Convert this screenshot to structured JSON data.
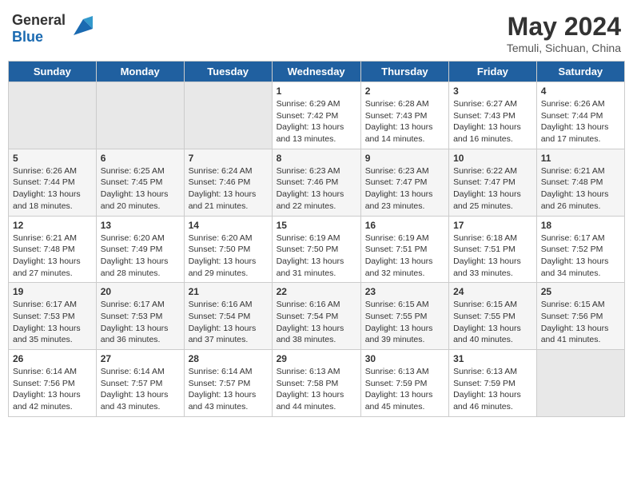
{
  "header": {
    "logo_general": "General",
    "logo_blue": "Blue",
    "title": "May 2024",
    "subtitle": "Temuli, Sichuan, China"
  },
  "days_of_week": [
    "Sunday",
    "Monday",
    "Tuesday",
    "Wednesday",
    "Thursday",
    "Friday",
    "Saturday"
  ],
  "weeks": [
    {
      "days": [
        {
          "num": "",
          "info": ""
        },
        {
          "num": "",
          "info": ""
        },
        {
          "num": "",
          "info": ""
        },
        {
          "num": "1",
          "info": "Sunrise: 6:29 AM\nSunset: 7:42 PM\nDaylight: 13 hours\nand 13 minutes."
        },
        {
          "num": "2",
          "info": "Sunrise: 6:28 AM\nSunset: 7:43 PM\nDaylight: 13 hours\nand 14 minutes."
        },
        {
          "num": "3",
          "info": "Sunrise: 6:27 AM\nSunset: 7:43 PM\nDaylight: 13 hours\nand 16 minutes."
        },
        {
          "num": "4",
          "info": "Sunrise: 6:26 AM\nSunset: 7:44 PM\nDaylight: 13 hours\nand 17 minutes."
        }
      ]
    },
    {
      "days": [
        {
          "num": "5",
          "info": "Sunrise: 6:26 AM\nSunset: 7:44 PM\nDaylight: 13 hours\nand 18 minutes."
        },
        {
          "num": "6",
          "info": "Sunrise: 6:25 AM\nSunset: 7:45 PM\nDaylight: 13 hours\nand 20 minutes."
        },
        {
          "num": "7",
          "info": "Sunrise: 6:24 AM\nSunset: 7:46 PM\nDaylight: 13 hours\nand 21 minutes."
        },
        {
          "num": "8",
          "info": "Sunrise: 6:23 AM\nSunset: 7:46 PM\nDaylight: 13 hours\nand 22 minutes."
        },
        {
          "num": "9",
          "info": "Sunrise: 6:23 AM\nSunset: 7:47 PM\nDaylight: 13 hours\nand 23 minutes."
        },
        {
          "num": "10",
          "info": "Sunrise: 6:22 AM\nSunset: 7:47 PM\nDaylight: 13 hours\nand 25 minutes."
        },
        {
          "num": "11",
          "info": "Sunrise: 6:21 AM\nSunset: 7:48 PM\nDaylight: 13 hours\nand 26 minutes."
        }
      ]
    },
    {
      "days": [
        {
          "num": "12",
          "info": "Sunrise: 6:21 AM\nSunset: 7:48 PM\nDaylight: 13 hours\nand 27 minutes."
        },
        {
          "num": "13",
          "info": "Sunrise: 6:20 AM\nSunset: 7:49 PM\nDaylight: 13 hours\nand 28 minutes."
        },
        {
          "num": "14",
          "info": "Sunrise: 6:20 AM\nSunset: 7:50 PM\nDaylight: 13 hours\nand 29 minutes."
        },
        {
          "num": "15",
          "info": "Sunrise: 6:19 AM\nSunset: 7:50 PM\nDaylight: 13 hours\nand 31 minutes."
        },
        {
          "num": "16",
          "info": "Sunrise: 6:19 AM\nSunset: 7:51 PM\nDaylight: 13 hours\nand 32 minutes."
        },
        {
          "num": "17",
          "info": "Sunrise: 6:18 AM\nSunset: 7:51 PM\nDaylight: 13 hours\nand 33 minutes."
        },
        {
          "num": "18",
          "info": "Sunrise: 6:17 AM\nSunset: 7:52 PM\nDaylight: 13 hours\nand 34 minutes."
        }
      ]
    },
    {
      "days": [
        {
          "num": "19",
          "info": "Sunrise: 6:17 AM\nSunset: 7:53 PM\nDaylight: 13 hours\nand 35 minutes."
        },
        {
          "num": "20",
          "info": "Sunrise: 6:17 AM\nSunset: 7:53 PM\nDaylight: 13 hours\nand 36 minutes."
        },
        {
          "num": "21",
          "info": "Sunrise: 6:16 AM\nSunset: 7:54 PM\nDaylight: 13 hours\nand 37 minutes."
        },
        {
          "num": "22",
          "info": "Sunrise: 6:16 AM\nSunset: 7:54 PM\nDaylight: 13 hours\nand 38 minutes."
        },
        {
          "num": "23",
          "info": "Sunrise: 6:15 AM\nSunset: 7:55 PM\nDaylight: 13 hours\nand 39 minutes."
        },
        {
          "num": "24",
          "info": "Sunrise: 6:15 AM\nSunset: 7:55 PM\nDaylight: 13 hours\nand 40 minutes."
        },
        {
          "num": "25",
          "info": "Sunrise: 6:15 AM\nSunset: 7:56 PM\nDaylight: 13 hours\nand 41 minutes."
        }
      ]
    },
    {
      "days": [
        {
          "num": "26",
          "info": "Sunrise: 6:14 AM\nSunset: 7:56 PM\nDaylight: 13 hours\nand 42 minutes."
        },
        {
          "num": "27",
          "info": "Sunrise: 6:14 AM\nSunset: 7:57 PM\nDaylight: 13 hours\nand 43 minutes."
        },
        {
          "num": "28",
          "info": "Sunrise: 6:14 AM\nSunset: 7:57 PM\nDaylight: 13 hours\nand 43 minutes."
        },
        {
          "num": "29",
          "info": "Sunrise: 6:13 AM\nSunset: 7:58 PM\nDaylight: 13 hours\nand 44 minutes."
        },
        {
          "num": "30",
          "info": "Sunrise: 6:13 AM\nSunset: 7:59 PM\nDaylight: 13 hours\nand 45 minutes."
        },
        {
          "num": "31",
          "info": "Sunrise: 6:13 AM\nSunset: 7:59 PM\nDaylight: 13 hours\nand 46 minutes."
        },
        {
          "num": "",
          "info": ""
        }
      ]
    }
  ]
}
